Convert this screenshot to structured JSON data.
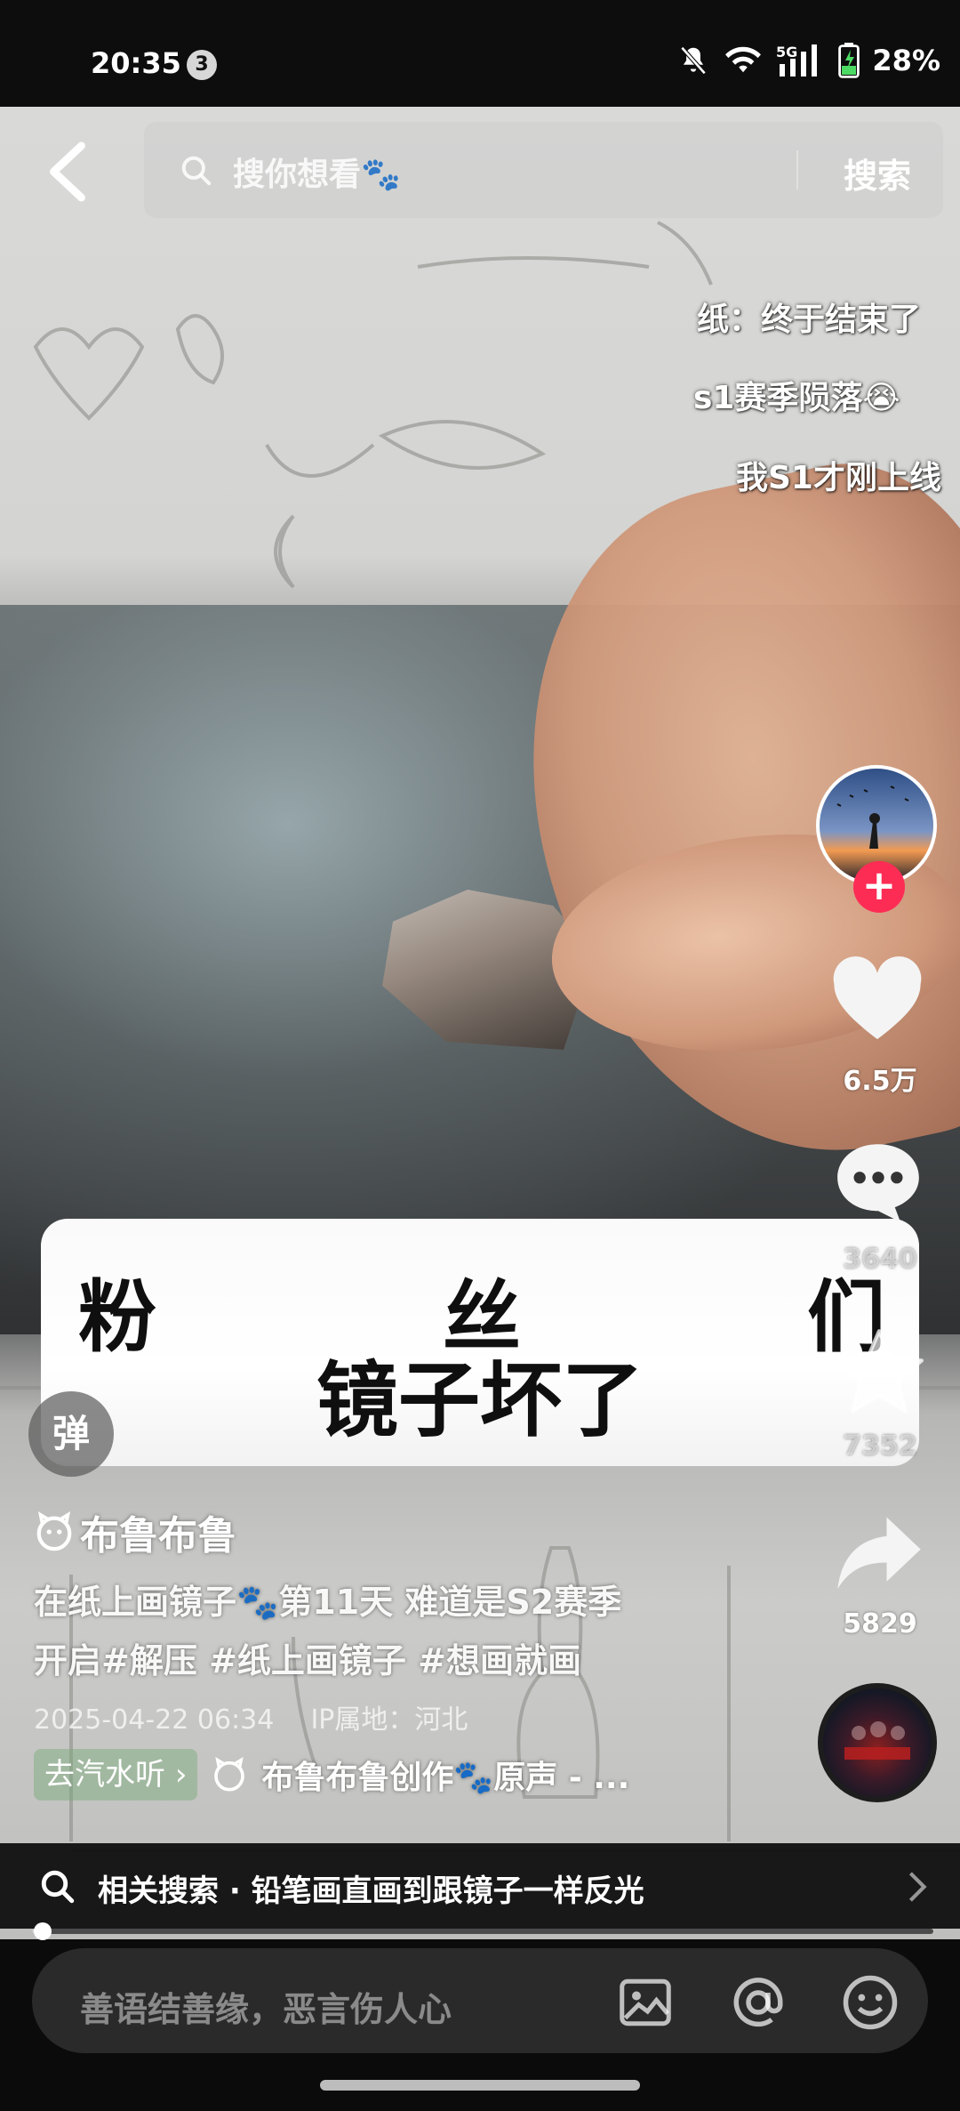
{
  "status_bar": {
    "time": "20:35",
    "notification_count": "3",
    "network": "5G",
    "battery": "28%"
  },
  "top_bar": {
    "search_placeholder": "搜你想看🐾",
    "search_button": "搜索"
  },
  "danmaku": [
    "纸：终于结束了",
    "s1赛季陨落😭",
    "我S1才刚上线"
  ],
  "subtitle": {
    "line1_chars": [
      "粉",
      "丝",
      "们"
    ],
    "line2": "镜子坏了"
  },
  "right_rail": {
    "likes": "6.5万",
    "comments": "3640",
    "favorites": "7352",
    "shares": "5829",
    "follow_symbol": "+"
  },
  "danmu_toggle_label": "弹",
  "video_info": {
    "author": "布鲁布鲁",
    "description_line1": "在纸上画镜子🐾第11天 难道是S2赛季",
    "description_line2": "开启#解压 #纸上画镜子 #想画就画",
    "date": "2025-04-22 06:34",
    "ip_location": "IP属地：河北",
    "listen_button": "去汽水听",
    "music": "布鲁布鲁创作🐾原声 - ..."
  },
  "related_search": {
    "text": "相关搜索 · 铅笔画直画到跟镜子一样反光"
  },
  "progress": {
    "fraction": 0.012
  },
  "comment_input": {
    "placeholder": "善语结善缘，恶言伤人心"
  },
  "colors": {
    "accent": "#fd2c55",
    "background": "#0b0b0b",
    "comment_box": "#2a2a2a"
  }
}
